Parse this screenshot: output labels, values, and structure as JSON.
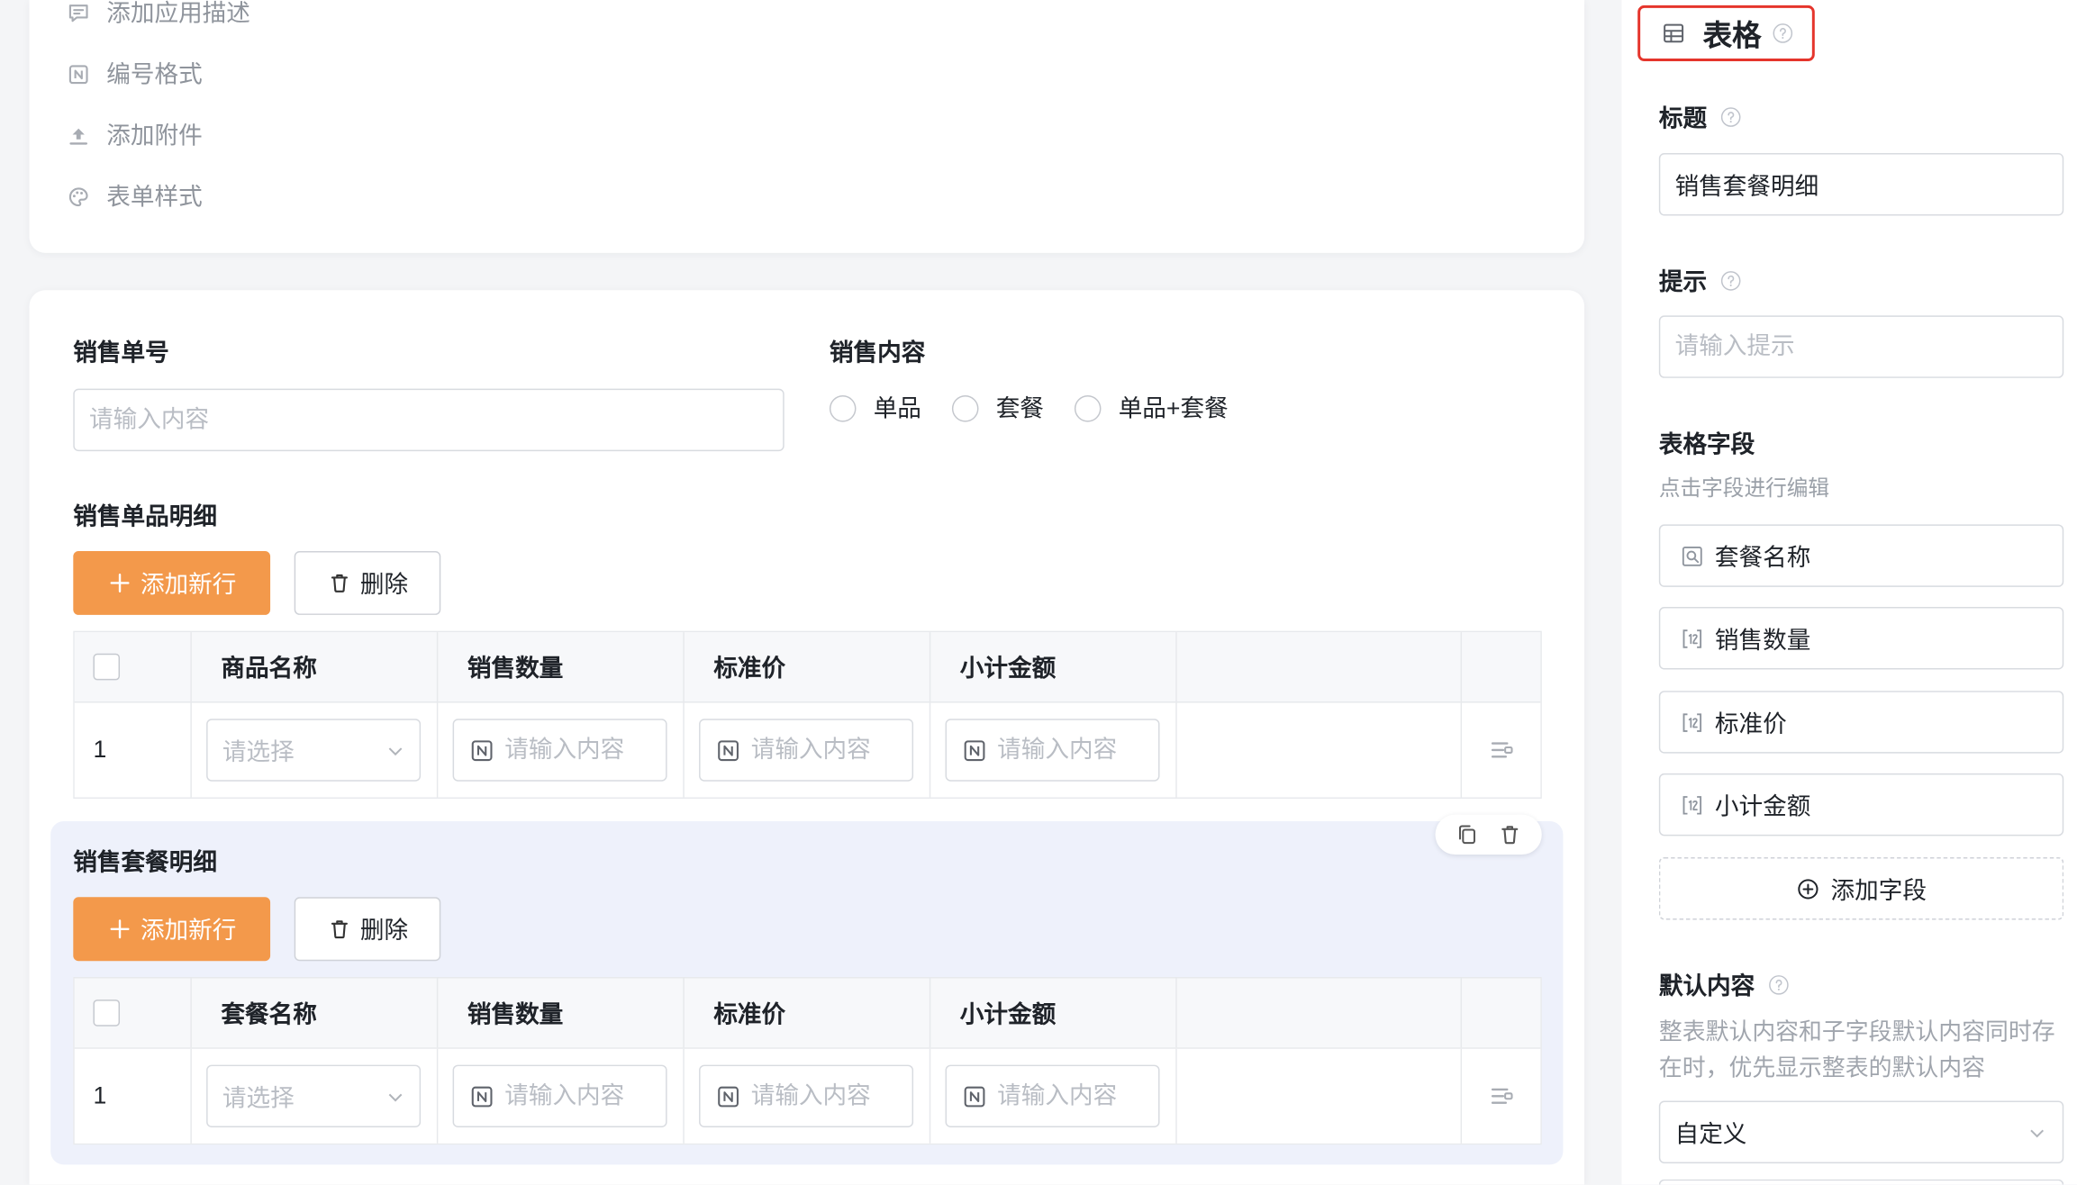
{
  "top_menu": {
    "items": [
      {
        "icon": "comment-icon",
        "label": "添加应用描述"
      },
      {
        "icon": "number-format-icon",
        "label": "编号格式"
      },
      {
        "icon": "upload-icon",
        "label": "添加附件"
      },
      {
        "icon": "palette-icon",
        "label": "表单样式"
      }
    ]
  },
  "form": {
    "sales_no": {
      "label": "销售单号",
      "placeholder": "请输入内容"
    },
    "sales_content": {
      "label": "销售内容",
      "options": [
        "单品",
        "套餐",
        "单品+套餐"
      ]
    },
    "single_detail": {
      "title": "销售单品明细",
      "add_row_label": "添加新行",
      "delete_label": "删除",
      "columns": [
        "商品名称",
        "销售数量",
        "标准价",
        "小计金额"
      ],
      "rows": [
        {
          "index": "1",
          "name_placeholder": "请选择",
          "quantity_placeholder": "请输入内容",
          "price_placeholder": "请输入内容",
          "subtotal_placeholder": "请输入内容"
        }
      ]
    },
    "package_detail": {
      "selected": true,
      "title": "销售套餐明细",
      "add_row_label": "添加新行",
      "delete_label": "删除",
      "columns": [
        "套餐名称",
        "销售数量",
        "标准价",
        "小计金额"
      ],
      "rows": [
        {
          "index": "1",
          "name_placeholder": "请选择",
          "quantity_placeholder": "请输入内容",
          "price_placeholder": "请输入内容",
          "subtotal_placeholder": "请输入内容"
        }
      ]
    }
  },
  "panel": {
    "title": "表格",
    "title_field": {
      "label": "标题",
      "value": "销售套餐明细"
    },
    "hint_field": {
      "label": "提示",
      "placeholder": "请输入提示"
    },
    "fields": {
      "label": "表格字段",
      "hint": "点击字段进行编辑",
      "items": [
        {
          "icon": "lookup-field-icon",
          "label": "套餐名称"
        },
        {
          "icon": "number-field-icon",
          "label": "销售数量"
        },
        {
          "icon": "number-field-icon",
          "label": "标准价"
        },
        {
          "icon": "number-field-icon",
          "label": "小计金额"
        }
      ],
      "add_label": "添加字段"
    },
    "default_content": {
      "label": "默认内容",
      "description": "整表默认内容和子字段默认内容同时存在时，优先显示整表的默认内容",
      "value": "自定义"
    }
  },
  "colors": {
    "page_bg": "#f4f5f7",
    "accent": "#f3994b",
    "highlight_border": "#e5352c",
    "selected_section_bg": "#eef1fb"
  }
}
